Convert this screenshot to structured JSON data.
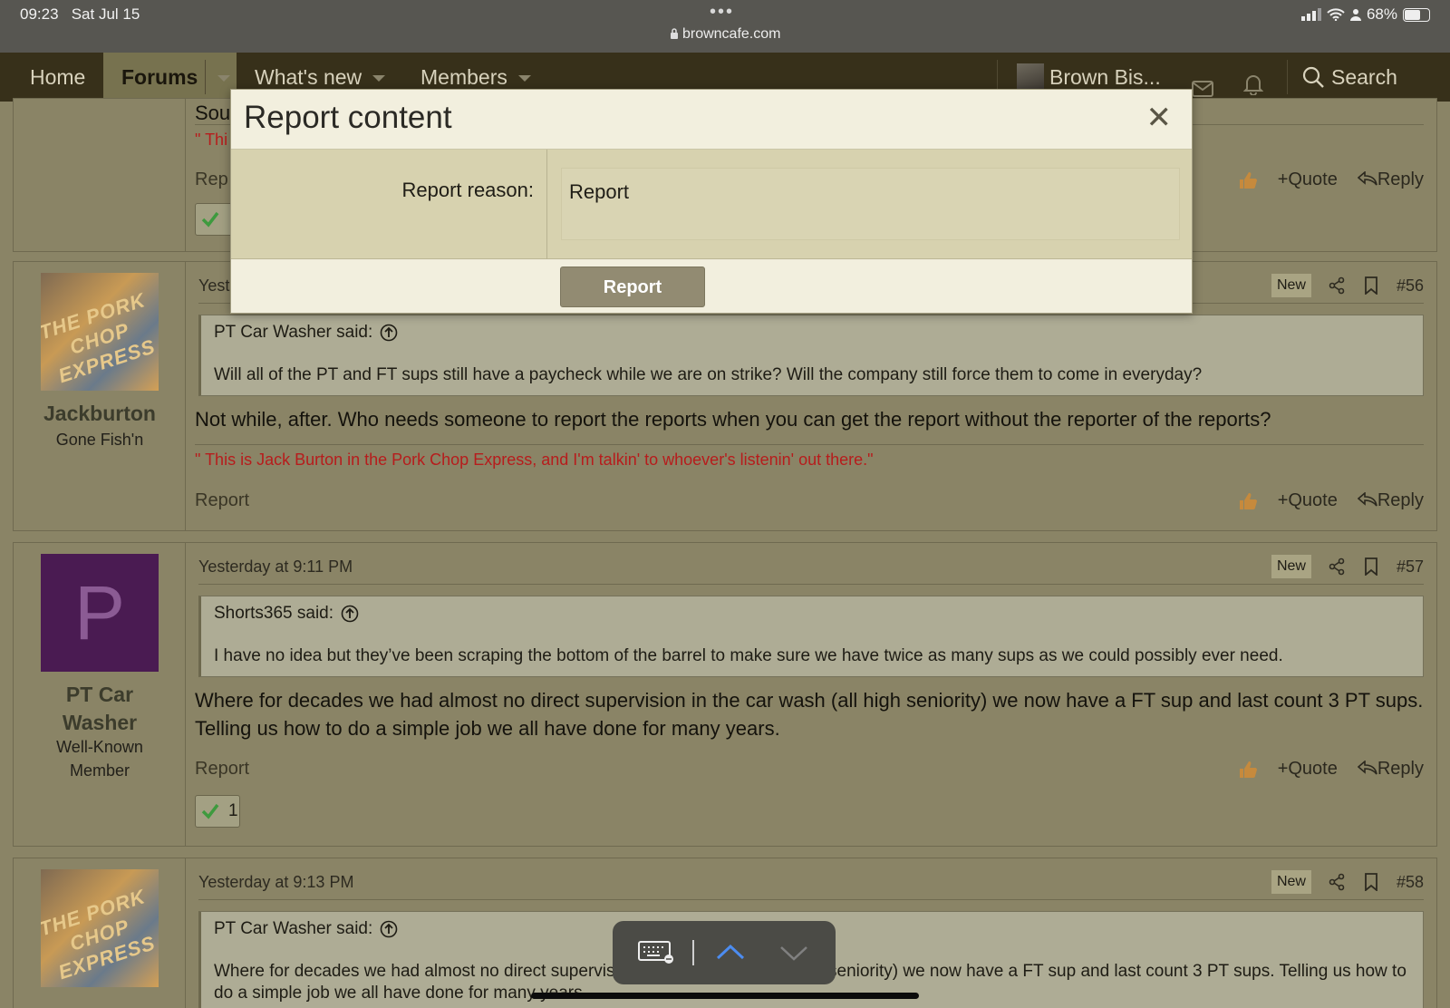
{
  "status_bar": {
    "time": "09:23",
    "date": "Sat Jul 15",
    "url": "browncafe.com",
    "battery_percent": "68%",
    "battery_level": 0.68
  },
  "nav": {
    "home": "Home",
    "forums": "Forums",
    "whats_new": "What's new",
    "members": "Members",
    "user": "Brown Bis...",
    "search": "Search"
  },
  "posts": [
    {
      "partial_body": "Sou",
      "partial_sig": "\" Thi",
      "partial_report": "Rep",
      "quote_action": "+Quote",
      "reply_action": "Reply"
    },
    {
      "date": "Yeste",
      "new_badge": "New",
      "number": "#56",
      "username": "Jackburton",
      "user_title": "Gone Fish'n",
      "quote_author": "PT Car Washer said:",
      "quote_text": "Will all of the PT and FT sups still have a paycheck while we are on strike? Will the company still force them to come in everyday?",
      "body": "Not while, after. Who needs someone to report the reports when you can get the report without the reporter of the reports?",
      "signature": "\" This is Jack Burton in the Pork Chop Express, and I'm talkin' to whoever's listenin' out there.\"",
      "report": "Report",
      "quote_action": "+Quote",
      "reply_action": "Reply"
    },
    {
      "date": "Yesterday at 9:11 PM",
      "new_badge": "New",
      "number": "#57",
      "avatar_letter": "P",
      "username_line1": "PT Car",
      "username_line2": "Washer",
      "user_title_line1": "Well-Known",
      "user_title_line2": "Member",
      "quote_author": "Shorts365 said:",
      "quote_text": "I have no idea but they’ve been scraping the bottom of the barrel to make sure we have twice as many sups as we could possibly ever need.",
      "body": "Where for decades we had almost no direct supervision in the car wash (all high seniority) we now have a FT sup and last count 3 PT sups. Telling us how to do a simple job we all have done for many years.",
      "report": "Report",
      "quote_action": "+Quote",
      "reply_action": "Reply",
      "reaction_count": "1"
    },
    {
      "date": "Yesterday at 9:13 PM",
      "new_badge": "New",
      "number": "#58",
      "quote_author": "PT Car Washer said:",
      "quote_text": "Where for decades we had almost no direct supervision in the car wash (all high seniority) we now have a FT sup and last count 3 PT sups. Telling us how to do a simple job we all have done for many years."
    }
  ],
  "dialog": {
    "title": "Report content",
    "reason_label": "Report reason:",
    "reason_value": "Report",
    "submit": "Report"
  },
  "icons": [
    "lock-icon",
    "signal-icon",
    "wifi-icon",
    "person-icon",
    "battery-icon",
    "mail-icon",
    "bell-icon",
    "search-icon",
    "close-icon",
    "share-icon",
    "bookmark-icon",
    "thumbs-up-icon",
    "reply-arrow-icon",
    "quote-link-icon",
    "check-icon",
    "keyboard-icon",
    "chevron-up-icon",
    "chevron-down-icon"
  ],
  "colors": {
    "accent": "#37301a",
    "signature": "#b71c1c",
    "tab_active": "#77724f"
  }
}
